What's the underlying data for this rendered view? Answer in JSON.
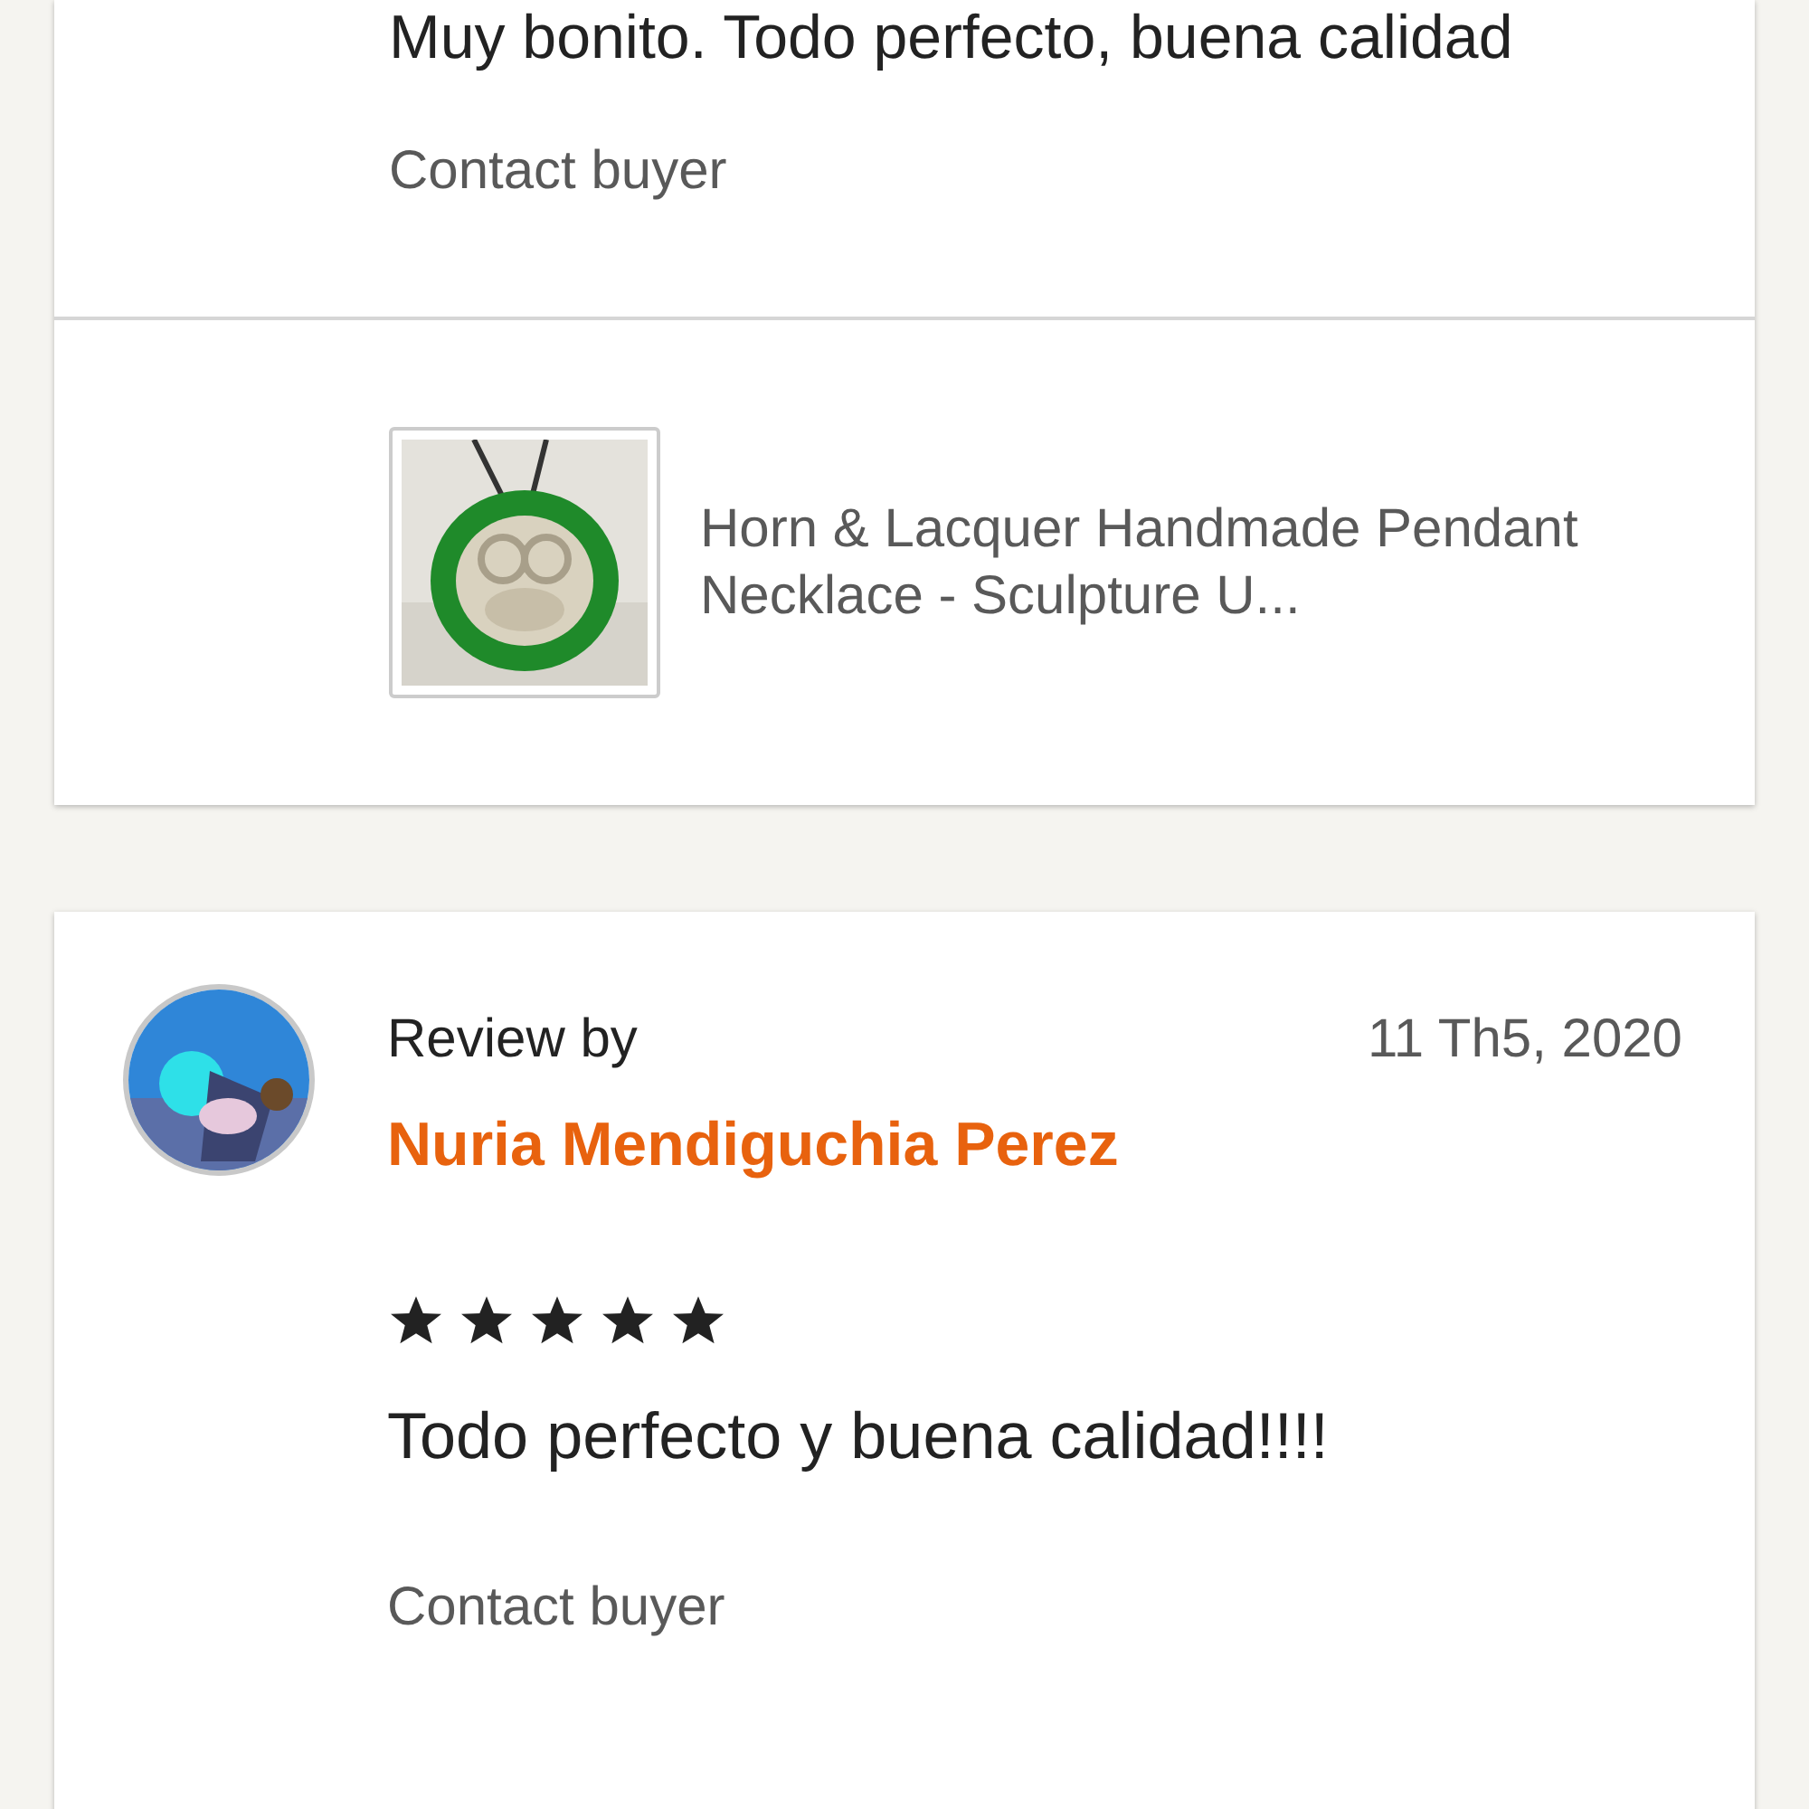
{
  "reviews": [
    {
      "text": "Muy bonito. Todo perfecto, buena calidad",
      "contact": "Contact buyer",
      "product": {
        "kind": "picture",
        "title": "Horn & Lacquer Handmade Pendant Necklace - Sculpture U..."
      }
    },
    {
      "label": "Review by",
      "reviewer": "Nuria Mendiguchia Perez",
      "date": "11 Th5, 2020",
      "stars": 5,
      "text": "Todo perfecto y buena calidad!!!!",
      "contact": "Contact buyer"
    }
  ]
}
